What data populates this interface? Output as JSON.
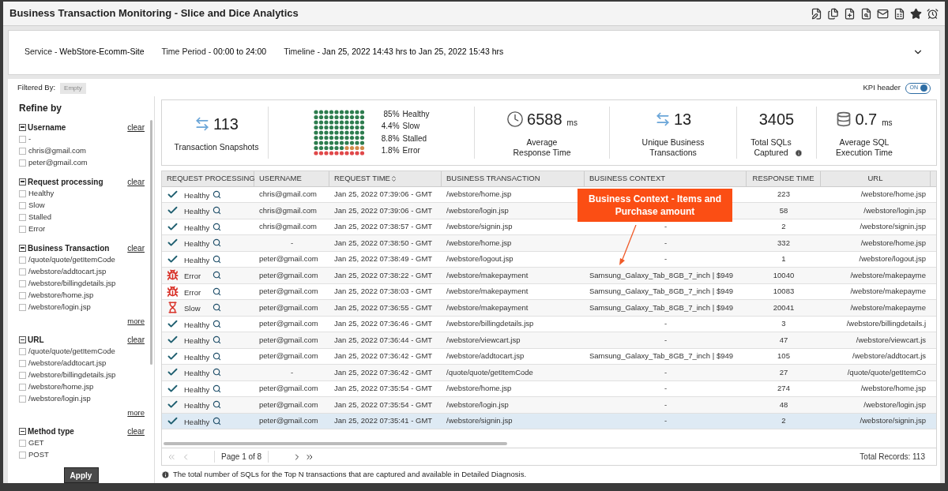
{
  "window": {
    "title": "Business Transaction Monitoring - Slice and Dice Analytics"
  },
  "header": {
    "items": [
      {
        "label": "Service - ",
        "value": "WebStore-Ecomm-Site"
      },
      {
        "label": "Time Period - ",
        "value": "00:00 to 24:00"
      },
      {
        "label": "Timeline - ",
        "value": "Jan 25, 2022 14:43 hrs to Jan 25, 2022 15:43 hrs"
      }
    ]
  },
  "filtered_by": {
    "label": "Filtered By:",
    "value": "Empty"
  },
  "kpi_header": {
    "label": "KPI header",
    "on": true,
    "state_text": "ON"
  },
  "sidebar": {
    "title": "Refine by",
    "apply": "Apply",
    "groups": [
      {
        "title": "Username",
        "clear": "clear",
        "expanded": true,
        "options": [
          {
            "label": "-",
            "checked": false
          },
          {
            "label": "chris@gmail.com",
            "checked": false
          },
          {
            "label": "peter@gmail.com",
            "checked": false
          }
        ]
      },
      {
        "title": "Request processing",
        "clear": "clear",
        "expanded": true,
        "options": [
          {
            "label": "Healthy",
            "checked": false
          },
          {
            "label": "Slow",
            "checked": false
          },
          {
            "label": "Stalled",
            "checked": false
          },
          {
            "label": "Error",
            "checked": false
          }
        ]
      },
      {
        "title": "Business Transaction",
        "clear": "clear",
        "expanded": true,
        "more": "more",
        "options": [
          {
            "label": "/quote/quote/getItemCode",
            "checked": false
          },
          {
            "label": "/webstore/addtocart.jsp",
            "checked": false
          },
          {
            "label": "/webstore/billingdetails.jsp",
            "checked": false
          },
          {
            "label": "/webstore/home.jsp",
            "checked": false
          },
          {
            "label": "/webstore/login.jsp",
            "checked": false
          }
        ]
      },
      {
        "title": "URL",
        "clear": "clear",
        "expanded": true,
        "more": "more",
        "options": [
          {
            "label": "/quote/quote/getItemCode",
            "checked": false
          },
          {
            "label": "/webstore/addtocart.jsp",
            "checked": false
          },
          {
            "label": "/webstore/billingdetails.jsp",
            "checked": false
          },
          {
            "label": "/webstore/home.jsp",
            "checked": false
          },
          {
            "label": "/webstore/login.jsp",
            "checked": false
          }
        ]
      },
      {
        "title": "Method type",
        "clear": "clear",
        "expanded": true,
        "options": [
          {
            "label": "GET",
            "checked": false
          },
          {
            "label": "POST",
            "checked": false
          }
        ]
      }
    ]
  },
  "kpis": [
    {
      "kind": "snapshots",
      "value": "113",
      "label": "Transaction Snapshots"
    },
    {
      "kind": "distribution",
      "legend": [
        {
          "pct": "85%",
          "label": "Healthy"
        },
        {
          "pct": "4.4%",
          "label": "Slow"
        },
        {
          "pct": "8.8%",
          "label": "Stalled"
        },
        {
          "pct": "1.8%",
          "label": "Error"
        }
      ]
    },
    {
      "kind": "response",
      "value": "6588",
      "unit": "ms",
      "label": "Average\nResponse Time"
    },
    {
      "kind": "unique",
      "value": "13",
      "label": "Unique Business\nTransactions"
    },
    {
      "kind": "sqls",
      "value": "3405",
      "label": "Total SQLs\nCaptured"
    },
    {
      "kind": "sqltime",
      "value": "0.7",
      "unit": "ms",
      "label": "Average SQL\nExecution Time"
    }
  ],
  "table": {
    "columns": [
      "REQUEST PROCESSING",
      "USERNAME",
      "REQUEST TIME",
      "BUSINESS TRANSACTION",
      "BUSINESS CONTEXT",
      "RESPONSE TIME",
      "URL"
    ],
    "rows": [
      {
        "kind": "healthy",
        "status_text": "Healthy",
        "username": "chris@gmail.com",
        "time": "Jan 25, 2022 07:39:06 - GMT",
        "transaction": "/webstore/home.jsp",
        "response": "223",
        "url": "/webstore/home.jsp",
        "selected": false
      },
      {
        "kind": "healthy",
        "status_text": "Healthy",
        "username": "chris@gmail.com",
        "time": "Jan 25, 2022 07:39:06 - GMT",
        "transaction": "/webstore/login.jsp",
        "response": "58",
        "url": "/webstore/login.jsp",
        "selected": false
      },
      {
        "kind": "healthy",
        "status_text": "Healthy",
        "username": "chris@gmail.com",
        "time": "Jan 25, 2022 07:38:57 - GMT",
        "transaction": "/webstore/signin.jsp",
        "context": "-",
        "response": "2",
        "url": "/webstore/signin.jsp",
        "selected": false
      },
      {
        "kind": "healthy",
        "status_text": "Healthy",
        "username": "-",
        "time": "Jan 25, 2022 07:38:50 - GMT",
        "transaction": "/webstore/home.jsp",
        "context": "-",
        "response": "332",
        "url": "/webstore/home.jsp",
        "selected": false
      },
      {
        "kind": "healthy",
        "status_text": "Healthy",
        "username": "peter@gmail.com",
        "time": "Jan 25, 2022 07:38:49 - GMT",
        "transaction": "/webstore/logout.jsp",
        "context": "-",
        "response": "1",
        "url": "/webstore/logout.jsp",
        "selected": false
      },
      {
        "kind": "error",
        "status_text": "Error",
        "username": "peter@gmail.com",
        "time": "Jan 25, 2022 07:38:22 - GMT",
        "transaction": "/webstore/makepayment",
        "context": "Samsung_Galaxy_Tab_8GB_7_inch | $949",
        "response": "10040",
        "url": "/webstore/makepayme",
        "selected": false
      },
      {
        "kind": "error",
        "status_text": "Error",
        "username": "peter@gmail.com",
        "time": "Jan 25, 2022 07:38:03 - GMT",
        "transaction": "/webstore/makepayment",
        "context": "Samsung_Galaxy_Tab_8GB_7_inch | $949",
        "response": "10083",
        "url": "/webstore/makepayme",
        "selected": false
      },
      {
        "kind": "slow",
        "status_text": "Slow",
        "username": "peter@gmail.com",
        "time": "Jan 25, 2022 07:36:55 - GMT",
        "transaction": "/webstore/makepayment",
        "context": "Samsung_Galaxy_Tab_8GB_7_inch | $949",
        "response": "20041",
        "url": "/webstore/makepayme",
        "selected": false
      },
      {
        "kind": "healthy",
        "status_text": "Healthy",
        "username": "peter@gmail.com",
        "time": "Jan 25, 2022 07:36:46 - GMT",
        "transaction": "/webstore/billingdetails.jsp",
        "context": "-",
        "response": "3",
        "url": "/webstore/billingdetails.j",
        "selected": false
      },
      {
        "kind": "healthy",
        "status_text": "Healthy",
        "username": "peter@gmail.com",
        "time": "Jan 25, 2022 07:36:44 - GMT",
        "transaction": "/webstore/viewcart.jsp",
        "context": "-",
        "response": "47",
        "url": "/webstore/viewcart.js",
        "selected": false
      },
      {
        "kind": "healthy",
        "status_text": "Healthy",
        "username": "peter@gmail.com",
        "time": "Jan 25, 2022 07:36:42 - GMT",
        "transaction": "/webstore/addtocart.jsp",
        "context": "Samsung_Galaxy_Tab_8GB_7_inch | $949",
        "response": "105",
        "url": "/webstore/addtocart.js",
        "selected": false
      },
      {
        "kind": "healthy",
        "status_text": "Healthy",
        "username": "-",
        "time": "Jan 25, 2022 07:36:42 - GMT",
        "transaction": "/quote/quote/getItemCode",
        "context": "-",
        "response": "27",
        "url": "/quote/quote/getItemCo",
        "selected": false
      },
      {
        "kind": "healthy",
        "status_text": "Healthy",
        "username": "peter@gmail.com",
        "time": "Jan 25, 2022 07:35:54 - GMT",
        "transaction": "/webstore/home.jsp",
        "context": "-",
        "response": "274",
        "url": "/webstore/home.jsp",
        "selected": false
      },
      {
        "kind": "healthy",
        "status_text": "Healthy",
        "username": "peter@gmail.com",
        "time": "Jan 25, 2022 07:35:54 - GMT",
        "transaction": "/webstore/login.jsp",
        "context": "-",
        "response": "48",
        "url": "/webstore/login.jsp",
        "selected": false
      },
      {
        "kind": "healthy",
        "status_text": "Healthy",
        "username": "peter@gmail.com",
        "time": "Jan 25, 2022 07:35:41 - GMT",
        "transaction": "/webstore/signin.jsp",
        "context": "-",
        "response": "2",
        "url": "/webstore/signin.jsp",
        "selected": true
      }
    ]
  },
  "callout": {
    "text": "Business Context - Items and Purchase amount"
  },
  "pagination": {
    "page": "Page 1 of 8",
    "total": "Total Records: 113"
  },
  "footnote": "The total number of SQLs for the Top N transactions that are captured and available in Detailed Diagnosis."
}
